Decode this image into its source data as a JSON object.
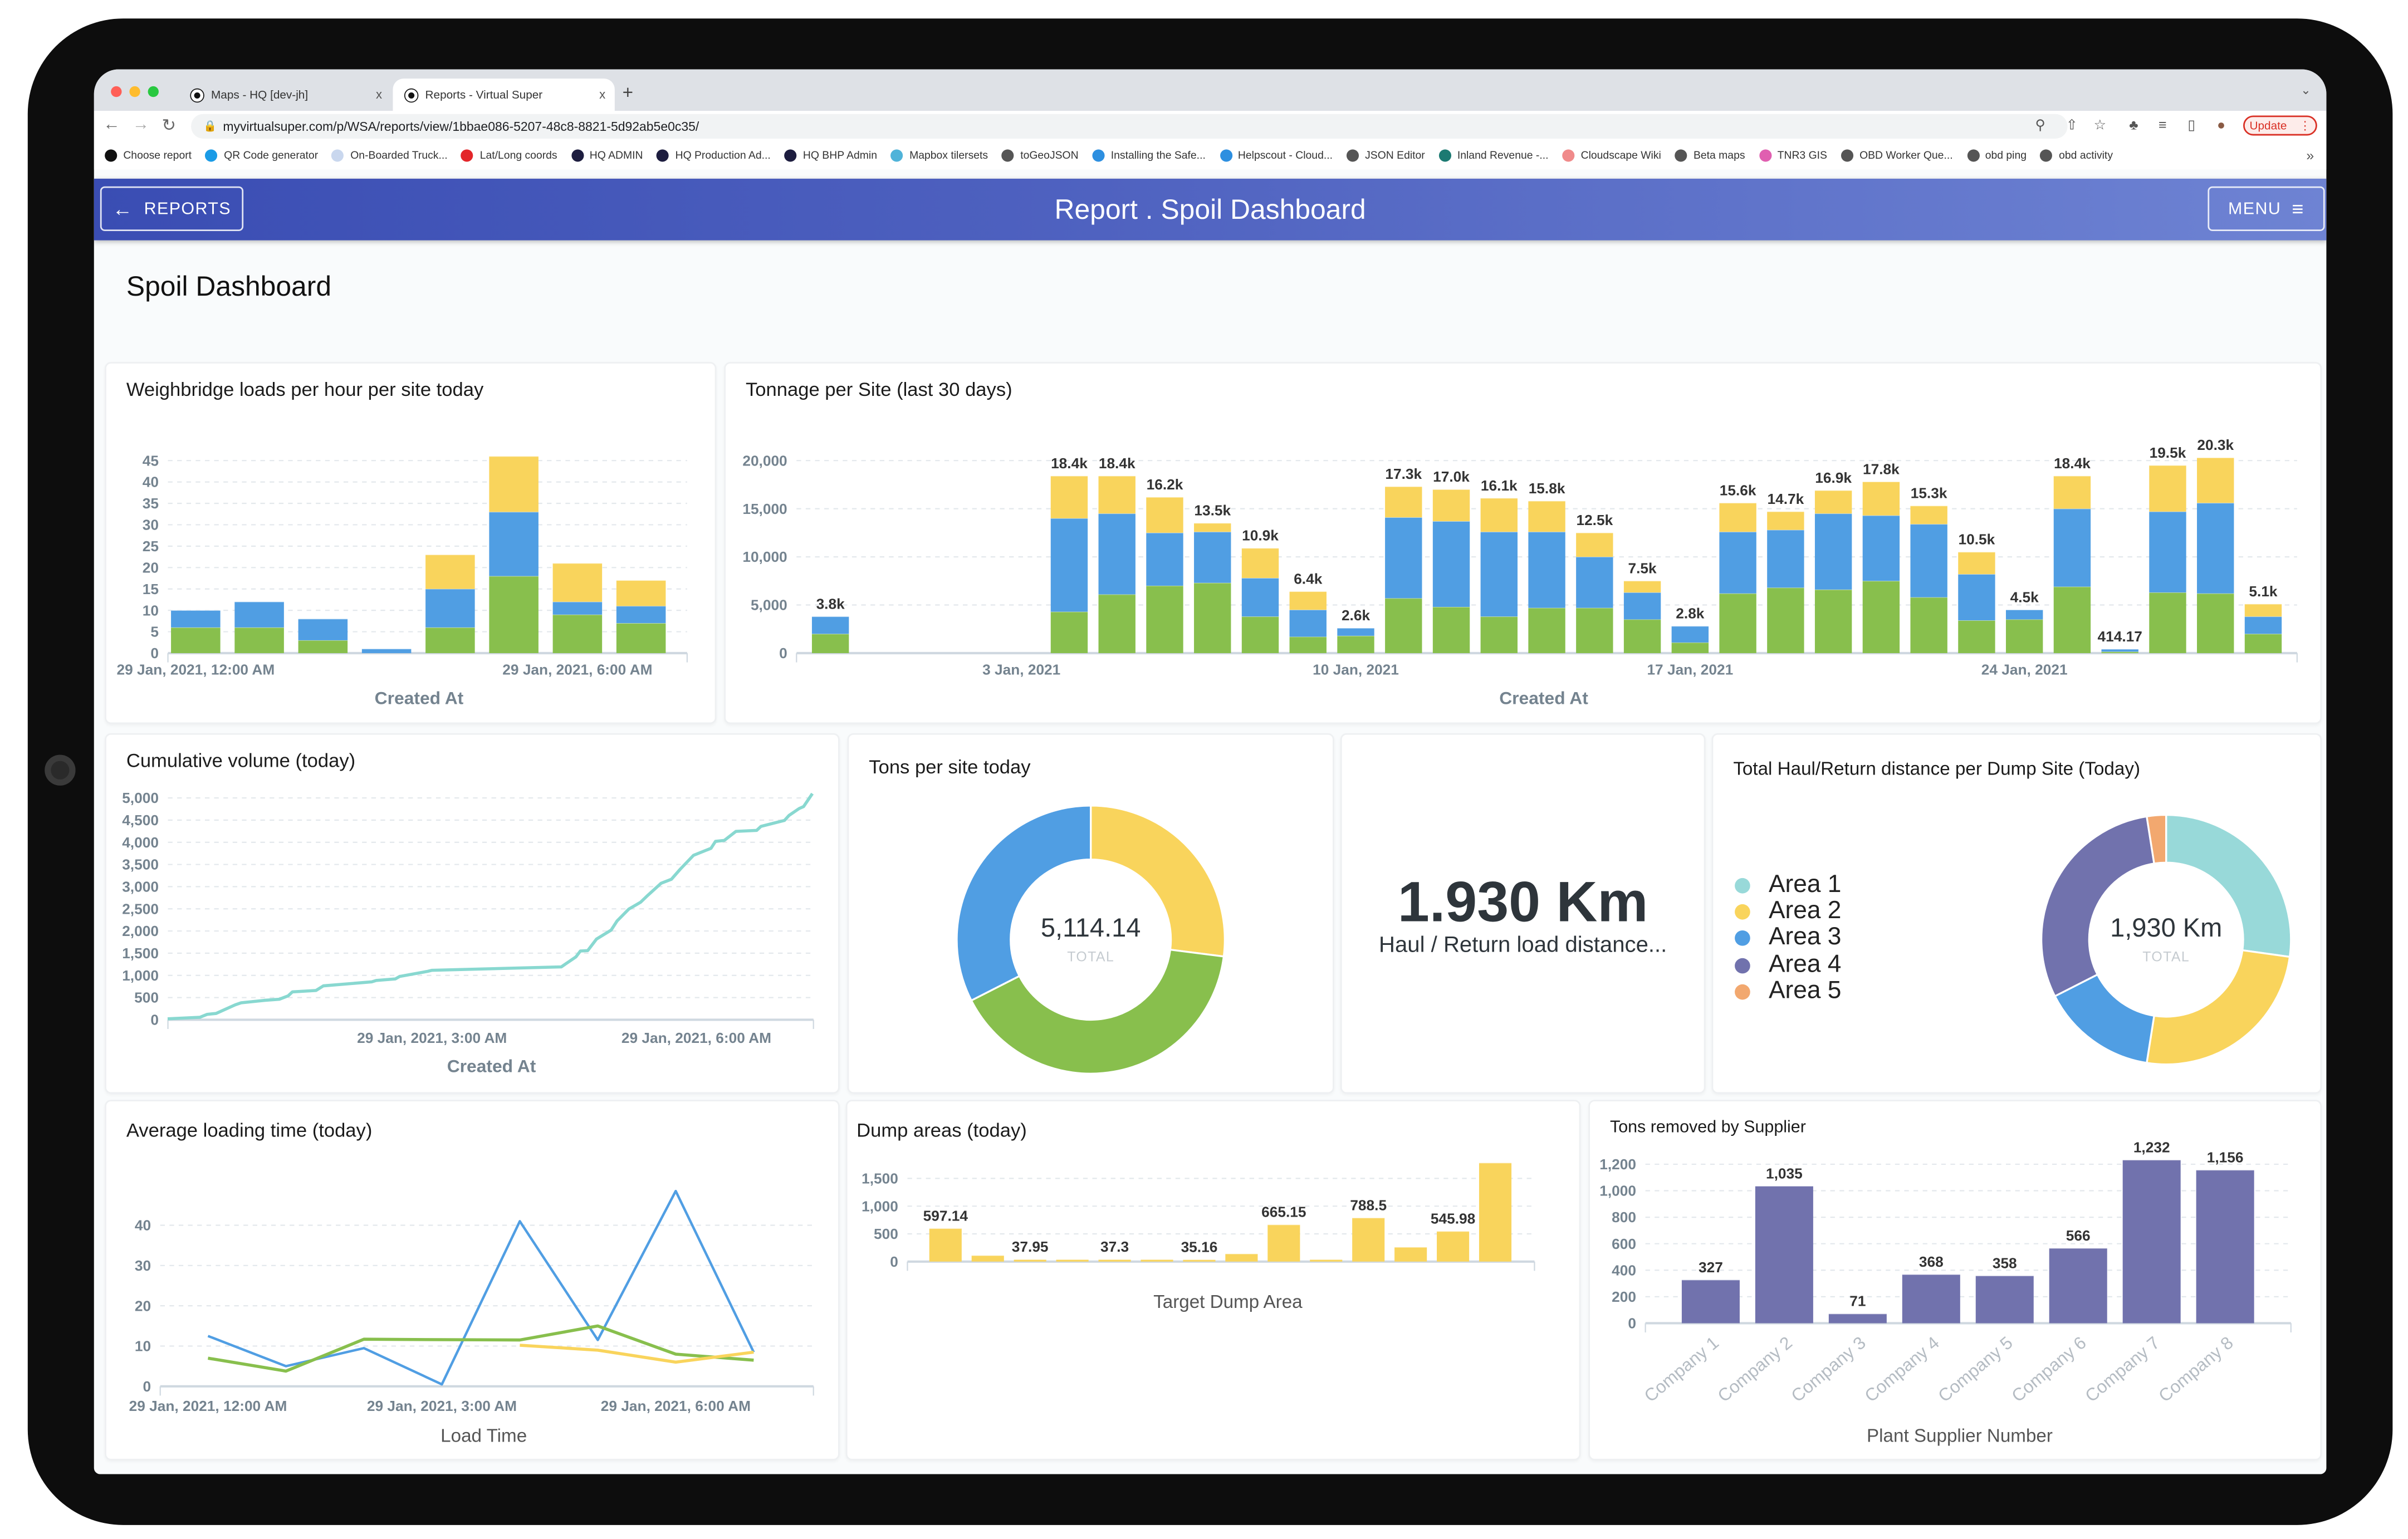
{
  "browser": {
    "tabs": [
      {
        "title": "Maps - HQ [dev-jh]",
        "close": "x"
      },
      {
        "title": "Reports - Virtual Super",
        "close": "x",
        "active": true
      }
    ],
    "new_tab": "+",
    "url": "myvirtualsuper.com/p/WSA/reports/view/1bbae086-5207-48c8-8821-5d92ab5e0c35/",
    "update_label": "Update",
    "bookmarks": [
      {
        "label": "Choose report",
        "color": "#111111"
      },
      {
        "label": "QR Code generator",
        "color": "#1a9be6"
      },
      {
        "label": "On-Boarded Truck...",
        "color": "#c9d7ee"
      },
      {
        "label": "Lat/Long coords",
        "color": "#e3262a"
      },
      {
        "label": "HQ ADMIN",
        "color": "#1d1d3f"
      },
      {
        "label": "HQ Production Ad...",
        "color": "#1d1d3f"
      },
      {
        "label": "HQ BHP Admin",
        "color": "#1d1d3f"
      },
      {
        "label": "Mapbox tilersets",
        "color": "#4fb3d9"
      },
      {
        "label": "toGeoJSON",
        "color": "#555555"
      },
      {
        "label": "Installing the Safe...",
        "color": "#2d8fe0"
      },
      {
        "label": "Helpscout - Cloud...",
        "color": "#2d8fe0"
      },
      {
        "label": "JSON Editor",
        "color": "#555555"
      },
      {
        "label": "Inland Revenue -...",
        "color": "#1c7a72"
      },
      {
        "label": "Cloudscape Wiki",
        "color": "#f08a8a"
      },
      {
        "label": "Beta maps",
        "color": "#555555"
      },
      {
        "label": "TNR3 GIS",
        "color": "#e05fb0"
      },
      {
        "label": "OBD Worker Que...",
        "color": "#555555"
      },
      {
        "label": "obd ping",
        "color": "#555555"
      },
      {
        "label": "obd activity",
        "color": "#555555"
      }
    ],
    "bookmarks_more": "»"
  },
  "header": {
    "back_label": "REPORTS",
    "title": "Report . Spoil Dashboard",
    "menu_label": "MENU"
  },
  "page_title": "Spoil Dashboard",
  "colors": {
    "green": "#88bf4d",
    "blue": "#509ee3",
    "yellow": "#f9d45c",
    "purple": "#7172ad",
    "teal": "#98d9d9",
    "orange": "#f2a86f",
    "line_teal": "#88d8d0"
  },
  "kpi": {
    "value": "1.930 Km",
    "label": "Haul / Return load distance..."
  },
  "chart_data": [
    {
      "title": "Weighbridge loads per hour per site today",
      "type": "bar",
      "stacked": true,
      "x": [
        "00:00",
        "01:00",
        "02:00",
        "03:00",
        "04:00",
        "05:00",
        "06:00",
        "07:00"
      ],
      "xticks": [
        {
          "at": "00:00",
          "label": "29 Jan, 2021, 12:00 AM"
        },
        {
          "at": "06:00",
          "label": "29 Jan, 2021, 6:00 AM"
        }
      ],
      "series": [
        {
          "color": "#88bf4d",
          "values": [
            6,
            6,
            3,
            0,
            6,
            18,
            9,
            7
          ]
        },
        {
          "color": "#509ee3",
          "values": [
            4,
            6,
            5,
            1,
            9,
            15,
            3,
            4
          ]
        },
        {
          "color": "#f9d45c",
          "values": [
            0,
            0,
            0,
            0,
            8,
            13,
            9,
            6
          ]
        }
      ],
      "yticks": [
        "0",
        "5",
        "10",
        "15",
        "20",
        "25",
        "30",
        "35",
        "40",
        "45"
      ],
      "ylim": [
        0,
        45
      ],
      "grid": true,
      "xlabel": "Created At"
    },
    {
      "title": "Tonnage per Site (last 30 days)",
      "type": "bar",
      "stacked": true,
      "x": [
        "2020-12-30",
        "2020-12-31",
        "2021-01-01",
        "2021-01-02",
        "2021-01-03",
        "2021-01-04",
        "2021-01-05",
        "2021-01-06",
        "2021-01-07",
        "2021-01-08",
        "2021-01-09",
        "2021-01-10",
        "2021-01-11",
        "2021-01-12",
        "2021-01-13",
        "2021-01-14",
        "2021-01-15",
        "2021-01-16",
        "2021-01-17",
        "2021-01-18",
        "2021-01-19",
        "2021-01-20",
        "2021-01-21",
        "2021-01-22",
        "2021-01-23",
        "2021-01-24",
        "2021-01-25",
        "2021-01-26",
        "2021-01-27",
        "2021-01-28",
        "2021-01-29"
      ],
      "xticks": [
        {
          "at": "2021-01-03",
          "label": "3 Jan, 2021"
        },
        {
          "at": "2021-01-10",
          "label": "10 Jan, 2021"
        },
        {
          "at": "2021-01-17",
          "label": "17 Jan, 2021"
        },
        {
          "at": "2021-01-24",
          "label": "24 Jan, 2021"
        }
      ],
      "series": [
        {
          "color": "#88bf4d",
          "values": [
            2000,
            0,
            0,
            0,
            0,
            4300,
            6100,
            7000,
            7300,
            3800,
            1700,
            1800,
            5700,
            4800,
            3800,
            4700,
            4700,
            3500,
            1100,
            6200,
            6800,
            6600,
            7500,
            5800,
            3400,
            3500,
            6900,
            150,
            6300,
            6200,
            2000
          ]
        },
        {
          "color": "#509ee3",
          "values": [
            1800,
            0,
            0,
            0,
            0,
            9700,
            8400,
            5500,
            5300,
            4000,
            2800,
            800,
            8400,
            8900,
            8800,
            7900,
            5300,
            2800,
            1700,
            6400,
            6000,
            7900,
            6800,
            7600,
            4800,
            1000,
            8100,
            264.17,
            8400,
            9400,
            1800
          ]
        },
        {
          "color": "#f9d45c",
          "values": [
            0,
            0,
            0,
            0,
            0,
            4400,
            3900,
            3700,
            900,
            3100,
            1900,
            0,
            3200,
            3300,
            3500,
            3200,
            2500,
            1200,
            0,
            3000,
            1900,
            2400,
            3500,
            1900,
            2300,
            0,
            3400,
            0,
            4800,
            4700,
            1300
          ]
        }
      ],
      "labels": [
        "3.8k",
        "",
        "",
        "",
        "",
        "18.4k",
        "18.4k",
        "16.2k",
        "13.5k",
        "10.9k",
        "6.4k",
        "2.6k",
        "17.3k",
        "17.0k",
        "16.1k",
        "15.8k",
        "12.5k",
        "7.5k",
        "2.8k",
        "15.6k",
        "14.7k",
        "16.9k",
        "17.8k",
        "15.3k",
        "10.5k",
        "4.5k",
        "18.4k",
        "414.17",
        "19.5k",
        "20.3k",
        "5.1k"
      ],
      "yticks": [
        "0",
        "5,000",
        "10,000",
        "15,000",
        "20,000"
      ],
      "ylim": [
        0,
        20000
      ],
      "grid": true,
      "xlabel": "Created At"
    },
    {
      "title": "Cumulative volume (today)",
      "type": "line",
      "series": [
        {
          "color": "#88d8d0",
          "points": [
            [
              "00:00",
              22
            ],
            [
              "00:22",
              54
            ],
            [
              "00:27",
              121
            ],
            [
              "00:33",
              144
            ],
            [
              "00:46",
              337
            ],
            [
              "00:50",
              382
            ],
            [
              "01:06",
              436
            ],
            [
              "01:16",
              463
            ],
            [
              "01:22",
              539
            ],
            [
              "01:25",
              629
            ],
            [
              "01:41",
              660
            ],
            [
              "01:46",
              764
            ],
            [
              "02:19",
              853
            ],
            [
              "02:22",
              885
            ],
            [
              "02:35",
              921
            ],
            [
              "02:38",
              975
            ],
            [
              "02:57",
              1092
            ],
            [
              "03:00",
              1114
            ],
            [
              "04:28",
              1190
            ],
            [
              "04:38",
              1415
            ],
            [
              "04:41",
              1550
            ],
            [
              "04:46",
              1559
            ],
            [
              "04:52",
              1819
            ],
            [
              "05:02",
              2021
            ],
            [
              "05:06",
              2224
            ],
            [
              "05:14",
              2493
            ],
            [
              "05:22",
              2650
            ],
            [
              "05:27",
              2807
            ],
            [
              "05:36",
              3077
            ],
            [
              "05:43",
              3167
            ],
            [
              "05:49",
              3392
            ],
            [
              "05:58",
              3706
            ],
            [
              "06:10",
              3863
            ],
            [
              "06:13",
              4020
            ],
            [
              "06:19",
              4043
            ],
            [
              "06:27",
              4245
            ],
            [
              "06:41",
              4267
            ],
            [
              "06:44",
              4357
            ],
            [
              "07:00",
              4492
            ],
            [
              "07:03",
              4604
            ],
            [
              "07:10",
              4761
            ],
            [
              "07:13",
              4806
            ],
            [
              "07:19",
              5098
            ]
          ]
        }
      ],
      "xticks": [
        {
          "at": "03:00",
          "label": "29 Jan, 2021, 3:00 AM"
        },
        {
          "at": "06:00",
          "label": "29 Jan, 2021, 6:00 AM"
        }
      ],
      "yticks": [
        "0",
        "500",
        "1,000",
        "1,500",
        "2,000",
        "2,500",
        "3,000",
        "3,500",
        "4,000",
        "4,500",
        "5,000"
      ],
      "ylim": [
        0,
        5000
      ],
      "grid": true,
      "xlabel": "Created At"
    },
    {
      "title": "Tons per site today",
      "type": "pie",
      "donut": true,
      "slices": [
        {
          "color": "#f9d45c",
          "value": 1381
        },
        {
          "color": "#88bf4d",
          "value": 2071
        },
        {
          "color": "#509ee3",
          "value": 1662
        }
      ],
      "center_value": "5,114.14",
      "center_label": "TOTAL"
    },
    {
      "title": "Total Haul/Return distance per Dump Site (Today)",
      "type": "pie",
      "donut": true,
      "slices": [
        {
          "name": "Area 1",
          "color": "#98d9d9",
          "value": 525
        },
        {
          "name": "Area 2",
          "color": "#f9d45c",
          "value": 488
        },
        {
          "name": "Area 3",
          "color": "#509ee3",
          "value": 290
        },
        {
          "name": "Area 4",
          "color": "#7172ad",
          "value": 579
        },
        {
          "name": "Area 5",
          "color": "#f2a86f",
          "value": 48
        }
      ],
      "legend": "left",
      "center_value": "1,930 Km",
      "center_label": "TOTAL"
    },
    {
      "title": "Average loading time (today)",
      "type": "line",
      "series": [
        {
          "color": "#509ee3",
          "points": [
            [
              "00:00",
              12.5
            ],
            [
              "01:00",
              5
            ],
            [
              "02:00",
              9.5
            ],
            [
              "03:00",
              0.5
            ],
            [
              "04:00",
              41
            ],
            [
              "05:00",
              11.5
            ],
            [
              "06:00",
              48.5
            ],
            [
              "07:00",
              8.5
            ]
          ]
        },
        {
          "color": "#88bf4d",
          "points": [
            [
              "00:00",
              7
            ],
            [
              "01:00",
              3.8
            ],
            [
              "02:00",
              11.7
            ],
            [
              "03:00",
              11.6
            ],
            [
              "04:00",
              11.5
            ],
            [
              "05:00",
              15
            ],
            [
              "06:00",
              8
            ],
            [
              "07:00",
              6.5
            ]
          ]
        },
        {
          "color": "#f9d45c",
          "points": [
            [
              "04:00",
              10.2
            ],
            [
              "05:00",
              9
            ],
            [
              "06:00",
              6
            ],
            [
              "07:00",
              8.5
            ]
          ]
        }
      ],
      "xticks": [
        {
          "at": "00:00",
          "label": "29 Jan, 2021, 12:00 AM"
        },
        {
          "at": "03:00",
          "label": "29 Jan, 2021, 3:00 AM"
        },
        {
          "at": "06:00",
          "label": "29 Jan, 2021, 6:00 AM"
        }
      ],
      "yticks": [
        "0",
        "10",
        "20",
        "30",
        "40"
      ],
      "ylim": [
        0,
        50
      ],
      "grid": true,
      "xlabel": "Load Time"
    },
    {
      "title": "Dump areas (today)",
      "type": "bar",
      "series": [
        {
          "color": "#f9d45c",
          "values": [
            597.14,
            110,
            37.95,
            37,
            37.3,
            37,
            35.16,
            140,
            665.15,
            37,
            788.5,
            260,
            545.98,
            1780
          ]
        }
      ],
      "labels": [
        "597.14",
        "",
        "37.95",
        "",
        "37.3",
        "",
        "35.16",
        "",
        "665.15",
        "",
        "788.5",
        "",
        "545.98",
        ""
      ],
      "yticks": [
        "0",
        "500",
        "1,000",
        "1,500"
      ],
      "ylim": [
        0,
        1800
      ],
      "grid": true,
      "xlabel": "Target Dump Area"
    },
    {
      "title": "Tons removed by Supplier",
      "type": "bar",
      "categories": [
        "Company 1",
        "Company 2",
        "Company 3",
        "Company 4",
        "Company 5",
        "Company 6",
        "Company 7",
        "Company 8"
      ],
      "series": [
        {
          "color": "#7172ad",
          "values": [
            327,
            1035,
            71,
            368,
            358,
            566,
            1232,
            1156
          ]
        }
      ],
      "labels": [
        "327",
        "1,035",
        "71",
        "368",
        "358",
        "566",
        "1,232",
        "1,156"
      ],
      "yticks": [
        "0",
        "200",
        "400",
        "600",
        "800",
        "1,000",
        "1,200"
      ],
      "ylim": [
        0,
        1200
      ],
      "grid": true,
      "xlabel": "Plant Supplier Number"
    }
  ]
}
